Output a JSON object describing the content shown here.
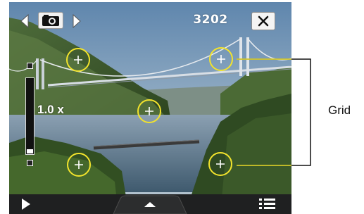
{
  "camera": {
    "counter": "3202",
    "zoom_label": "1.0 x",
    "zoom_level": 0.06,
    "grid_points": 5
  },
  "toolbar": {
    "prev_icon": "left-triangle",
    "mode_icon": "camera-icon",
    "next_icon": "right-triangle",
    "close_icon": "close-x"
  },
  "bottom": {
    "play_icon": "right-triangle",
    "expand_icon": "up-triangle",
    "menu_icon": "list-icon"
  },
  "annotation": {
    "label": "Grid"
  },
  "colors": {
    "grid_circle": "#f2e32c",
    "callout_line": "#111111",
    "bottom_bar": "#1f2021",
    "sky": "#7f9fbd",
    "water": "#5d7d96",
    "foliage": "#3e5a2a"
  }
}
